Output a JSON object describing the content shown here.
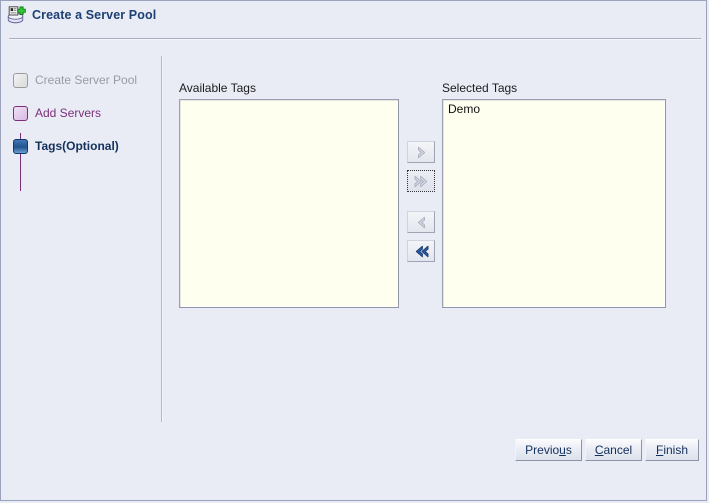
{
  "window": {
    "title": "Create a Server Pool",
    "title_icon": "server-pool-add-icon",
    "background_color": "#E9ECF5",
    "border_color": "#9AA3BB"
  },
  "sidebar": {
    "connector_color": "#7C2F79",
    "steps": [
      {
        "label": "Create Server Pool",
        "state": "completed",
        "icon": "step-square-gray-icon",
        "icon_color": "#DADADA"
      },
      {
        "label": "Add Servers",
        "state": "visited-link",
        "icon": "step-square-lavender-icon",
        "icon_color": "#D9B9E4"
      },
      {
        "label": "Tags(Optional)",
        "state": "current",
        "icon": "step-square-blue-icon",
        "icon_color": "#22548E"
      }
    ]
  },
  "main": {
    "available": {
      "label": "Available Tags",
      "items": []
    },
    "selected": {
      "label": "Selected Tags",
      "items": [
        {
          "text": "Demo"
        }
      ]
    },
    "transfer_buttons": [
      {
        "name": "move-right-button",
        "icon": "chevron-right-icon",
        "tooltip": "Move",
        "enabled": false,
        "focused": false
      },
      {
        "name": "move-all-right-button",
        "icon": "chevron-double-right-icon",
        "tooltip": "Move All",
        "enabled": false,
        "focused": true
      },
      {
        "name": "remove-left-button",
        "icon": "chevron-left-icon",
        "tooltip": "Remove",
        "enabled": false,
        "focused": false
      },
      {
        "name": "remove-all-left-button",
        "icon": "chevron-double-left-icon",
        "tooltip": "Remove All",
        "enabled": true,
        "focused": false
      }
    ]
  },
  "footer": {
    "previous": {
      "before": "Previo",
      "mnemonic": "u",
      "after": "s"
    },
    "cancel": {
      "before": "",
      "mnemonic": "C",
      "after": "ancel"
    },
    "finish": {
      "before": "",
      "mnemonic": "F",
      "after": "inish"
    }
  },
  "colors": {
    "listbox_background": "#FFFFF0",
    "listbox_border": "#9096A8",
    "enabled_chevron": "#1F4E9C",
    "disabled_chevron": "#A9AFBE",
    "title_text": "#1D3F73",
    "link_text": "#7C2F79",
    "disabled_text": "#9A9AA4"
  }
}
